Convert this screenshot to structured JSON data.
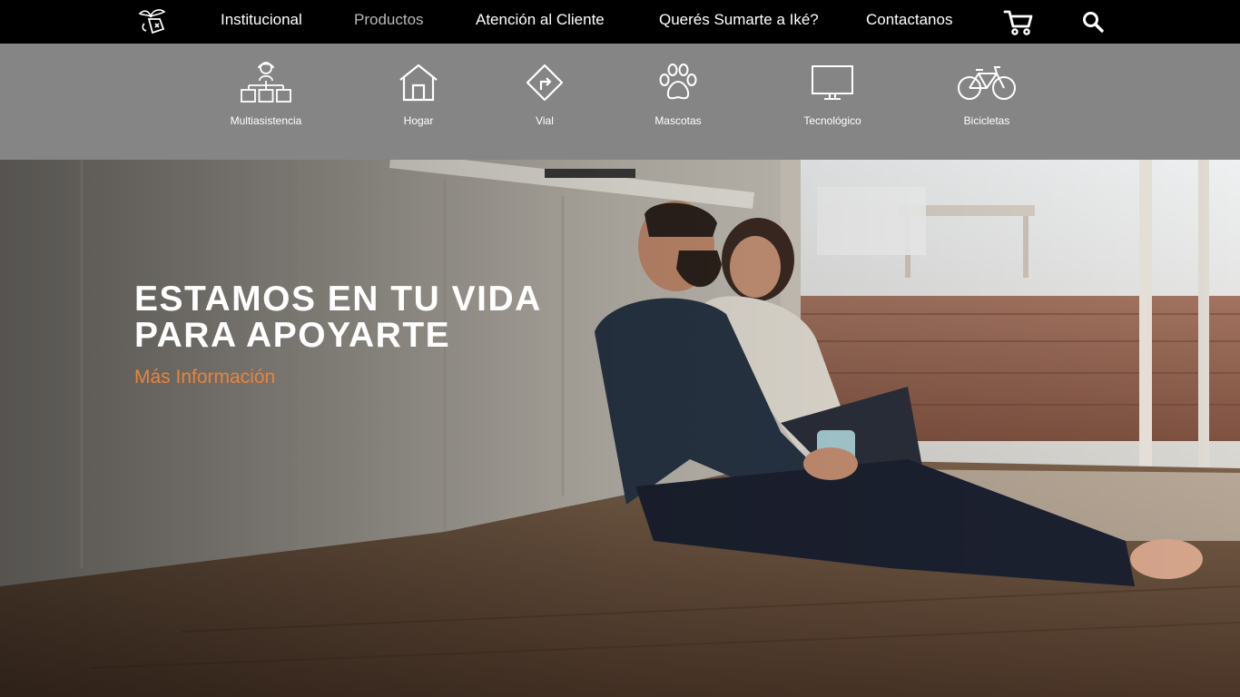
{
  "nav": {
    "links": [
      "Institucional",
      "Productos",
      "Atención al Cliente",
      "Querés Sumarte a Iké?",
      "Contactanos"
    ],
    "active": "Productos"
  },
  "products": [
    {
      "label": "Multiasistencia",
      "icon": "multiassistance-icon"
    },
    {
      "label": "Hogar",
      "icon": "house-icon"
    },
    {
      "label": "Vial",
      "icon": "road-sign-icon"
    },
    {
      "label": "Mascotas",
      "icon": "paw-icon"
    },
    {
      "label": "Tecnológico",
      "icon": "monitor-icon"
    },
    {
      "label": "Bicicletas",
      "icon": "bicycle-icon"
    }
  ],
  "hero": {
    "headline_line1": "ESTAMOS EN TU VIDA",
    "headline_line2": "PARA APOYARTE",
    "cta": "Más Información"
  },
  "colors": {
    "topbar": "#000000",
    "products_bar": "#858585",
    "cta": "#e8843a"
  }
}
